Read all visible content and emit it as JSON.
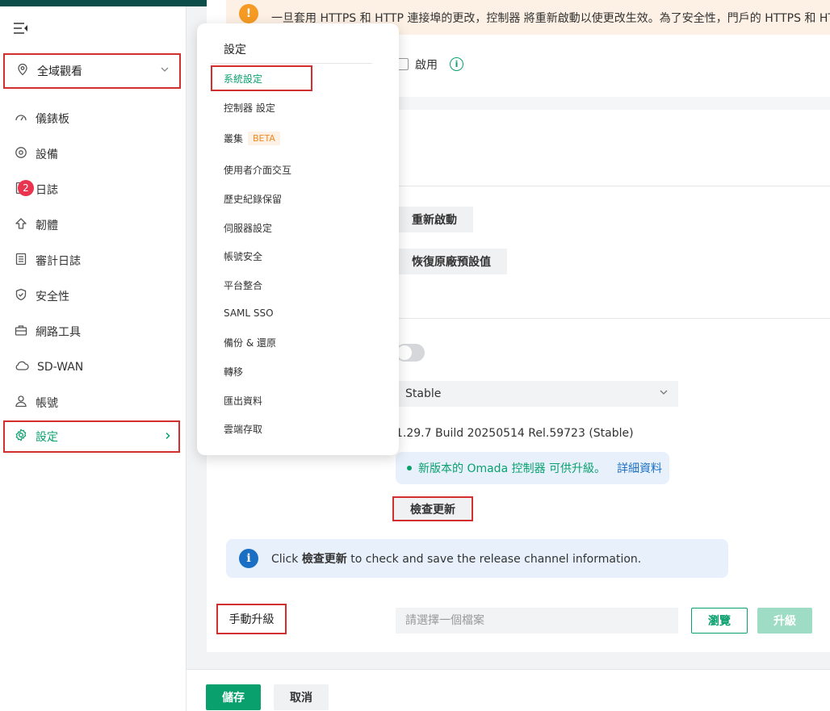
{
  "sidebar": {
    "site": "全域觀看",
    "items": [
      {
        "label": "儀錶板",
        "icon": "dashboard-icon"
      },
      {
        "label": "設備",
        "icon": "device-icon"
      },
      {
        "label": "日誌",
        "icon": "log-icon",
        "badge": "2"
      },
      {
        "label": "韌體",
        "icon": "upload-icon"
      },
      {
        "label": "審計日誌",
        "icon": "audit-log-icon"
      },
      {
        "label": "安全性",
        "icon": "shield-icon"
      },
      {
        "label": "網路工具",
        "icon": "toolbox-icon"
      },
      {
        "label": "SD-WAN",
        "icon": "cloud-icon"
      },
      {
        "label": "帳號",
        "icon": "user-icon"
      },
      {
        "label": "設定",
        "icon": "gear-icon"
      }
    ]
  },
  "warning": {
    "text": "一旦套用 HTTPS 和 HTTP 連接埠的更改，控制器 將重新啟動以使更改生效。為了安全性，門戶的 HTTPS 和 HTTP"
  },
  "https": {
    "enable_label": "啟用"
  },
  "actions": {
    "restart": "重新啟動",
    "factory_reset": "恢復原廠預設值"
  },
  "update": {
    "channel": "Stable",
    "version": "1.29.7 Build 20250514 Rel.59723 (Stable)",
    "available_msg": "新版本的 Omada 控制器 可供升級。",
    "details_link": "詳細資料",
    "check_button": "檢查更新",
    "info_prefix": "Click ",
    "info_bold": "檢查更新",
    "info_suffix": " to check and save the release channel information."
  },
  "manual": {
    "label": "手動升級",
    "placeholder": "請選擇一個檔案",
    "browse": "瀏覽",
    "upgrade": "升級"
  },
  "footer": {
    "save": "儲存",
    "cancel": "取消"
  },
  "dropdown": {
    "title": "設定",
    "items": [
      {
        "label": "系統設定"
      },
      {
        "label": "控制器 設定"
      },
      {
        "label": "叢集",
        "tag": "BETA"
      },
      {
        "label": "使用者介面交互"
      },
      {
        "label": "歷史紀錄保留"
      },
      {
        "label": "伺服器設定"
      },
      {
        "label": "帳號安全"
      },
      {
        "label": "平台整合"
      },
      {
        "label": "SAML SSO"
      },
      {
        "label": "備份 & 還原"
      },
      {
        "label": "轉移"
      },
      {
        "label": "匯出資料"
      },
      {
        "label": "雲端存取"
      }
    ]
  },
  "colors": {
    "accent": "#0aa06e",
    "highlight_border": "#d32f2f",
    "badge": "#e8344e",
    "warning": "#f59a23",
    "info": "#1a6fc4"
  }
}
